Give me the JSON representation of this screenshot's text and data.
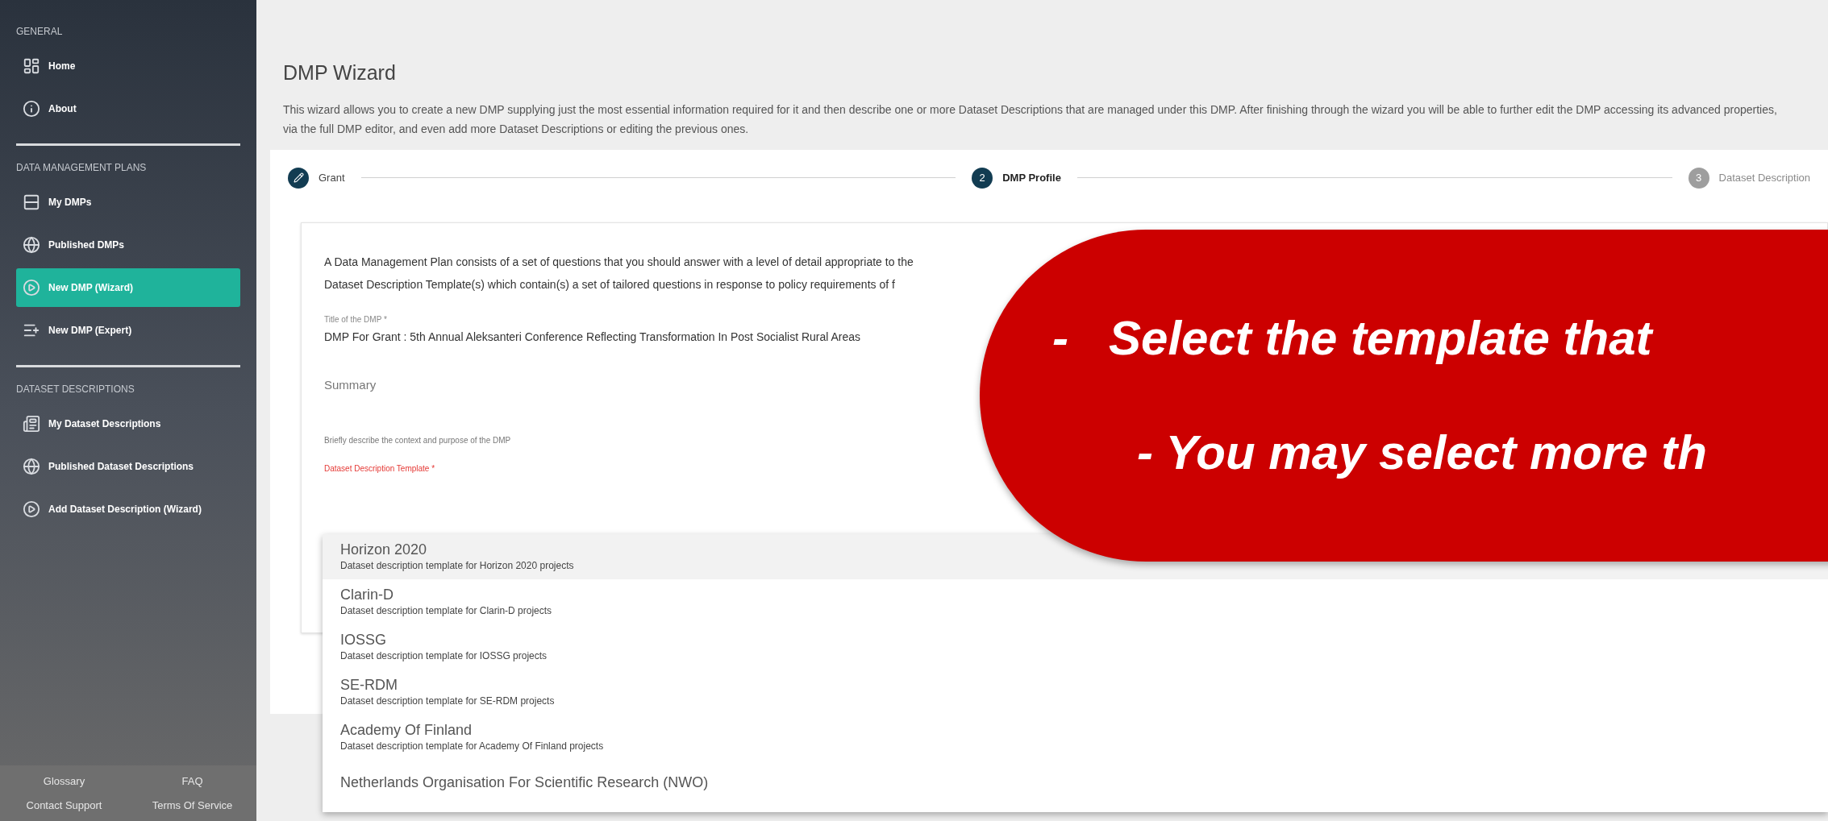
{
  "sidebar": {
    "sections": [
      {
        "heading": "GENERAL",
        "items": [
          {
            "label": "Home",
            "selected": false
          },
          {
            "label": "About",
            "selected": false
          }
        ]
      },
      {
        "heading": "DATA MANAGEMENT PLANS",
        "items": [
          {
            "label": "My DMPs",
            "selected": false
          },
          {
            "label": "Published DMPs",
            "selected": false
          },
          {
            "label": "New DMP (Wizard)",
            "selected": true
          },
          {
            "label": "New DMP (Expert)",
            "selected": false
          }
        ]
      },
      {
        "heading": "DATASET DESCRIPTIONS",
        "items": [
          {
            "label": "My Dataset Descriptions",
            "selected": false
          },
          {
            "label": "Published Dataset Descriptions",
            "selected": false
          },
          {
            "label": "Add Dataset Description (Wizard)",
            "selected": false
          }
        ]
      }
    ],
    "footer": [
      "Glossary",
      "FAQ",
      "Contact Support",
      "Terms Of Service"
    ]
  },
  "page": {
    "title": "DMP Wizard",
    "description": "This wizard allows you to create a new DMP supplying just the most essential information required for it and then describe one or more Dataset Descriptions that are managed under this DMP. After finishing through the wizard you will be able to further edit the DMP accessing its advanced properties, via the full DMP editor, and even add more Dataset Descriptions or editing the previous ones."
  },
  "stepper": [
    {
      "label": "Grant",
      "completed": true,
      "selected": false
    },
    {
      "number": "2",
      "label": "DMP Profile",
      "completed": false,
      "selected": true
    },
    {
      "number": "3",
      "label": "Dataset Description",
      "completed": false,
      "selected": false
    }
  ],
  "form": {
    "intro": [
      "A Data Management Plan consists of a set of questions that you should answer with a level of detail appropriate to the",
      "Dataset Description Template(s) which contain(s) a set of tailored questions in response to policy requirements of f"
    ],
    "title_field": {
      "label": "Title of the DMP *",
      "value": "DMP For Grant : 5th Annual Aleksanteri Conference Reflecting Transformation In Post Socialist Rural Areas"
    },
    "summary_field": {
      "placeholder": "Summary",
      "hint": "Briefly describe the context and purpose of the DMP"
    },
    "template_field": {
      "label": "Dataset Description Template *",
      "options": [
        {
          "name": "Horizon 2020",
          "description": "Dataset description template for Horizon 2020 projects",
          "selected": true
        },
        {
          "name": "Clarin-D",
          "description": "Dataset description template for Clarin-D projects",
          "selected": false
        },
        {
          "name": "IOSSG",
          "description": "Dataset description template for IOSSG projects",
          "selected": false
        },
        {
          "name": "SE-RDM",
          "description": "Dataset description template for SE-RDM projects",
          "selected": false
        },
        {
          "name": "Academy Of Finland",
          "description": "Dataset description template for Academy Of Finland projects",
          "selected": false
        },
        {
          "name": "Netherlands Organisation For Scientific Research (NWO)",
          "selected": false
        }
      ]
    }
  },
  "callout": {
    "lines": [
      "-   Select the template that",
      "- You may select more th"
    ]
  }
}
